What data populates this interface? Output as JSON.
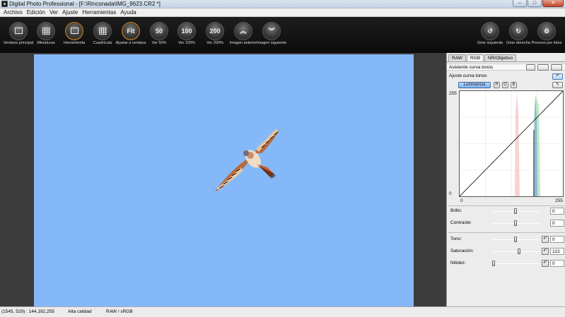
{
  "window": {
    "title": "Digital Photo Professional - [F:\\Rinconada\\IMG_9623.CR2 *]",
    "buttons": {
      "minimize": "–",
      "maximize": "□",
      "close": "✕"
    }
  },
  "menu": [
    "Archivo",
    "Edición",
    "Ver",
    "Ajuste",
    "Herramientas",
    "Ayuda"
  ],
  "toolbar": {
    "tools": [
      {
        "id": "ventana-principal",
        "label": "Ventana principal",
        "icon": "folder-icon",
        "glyph": ""
      },
      {
        "id": "miniaturas",
        "label": "Miniaturas",
        "icon": "thumbnails-icon",
        "glyph": ""
      },
      {
        "id": "herramienta",
        "label": "Herramienta",
        "icon": "tool-palette-icon",
        "glyph": ""
      },
      {
        "id": "cuadricula",
        "label": "Cuadrícula",
        "icon": "grid-icon",
        "glyph": ""
      },
      {
        "id": "ajustar-a-ventana",
        "label": "Ajustar a ventana",
        "icon": "fit-window-icon",
        "glyph": "Fit"
      },
      {
        "id": "ver-50",
        "label": "Ver 50%",
        "icon": "zoom-50-icon",
        "glyph": "50"
      },
      {
        "id": "ver-100",
        "label": "Ver 100%",
        "icon": "zoom-100-icon",
        "glyph": "100"
      },
      {
        "id": "ver-200",
        "label": "Ver 200%",
        "icon": "zoom-200-icon",
        "glyph": "200"
      },
      {
        "id": "imagen-anterior",
        "label": "Imagen anterior",
        "icon": "previous-image-icon",
        "glyph": "︽"
      },
      {
        "id": "imagen-siguiente",
        "label": "Imagen siguiente",
        "icon": "next-image-icon",
        "glyph": "︾"
      }
    ],
    "right_tools": [
      {
        "id": "girar-izquierda",
        "label": "Girar izquierda",
        "icon": "rotate-left-icon",
        "glyph": "↺"
      },
      {
        "id": "girar-derecha",
        "label": "Girar derecha",
        "icon": "rotate-right-icon",
        "glyph": "↻"
      },
      {
        "id": "proceso-por-lotes",
        "label": "Proceso por lotes",
        "icon": "batch-process-icon",
        "glyph": "⚙"
      }
    ]
  },
  "viewer": {
    "background_color": "#85b8f8"
  },
  "panel": {
    "tabs": [
      "RAW",
      "RGB",
      "NR/Objetivo"
    ],
    "active_tab": "RGB",
    "assist_label": "Asistente curva tonos",
    "adjust_label": "Ajuste curva tonos",
    "channels": [
      "Luminancia",
      "R",
      "G",
      "B"
    ],
    "active_channel": "Luminancia",
    "curve": {
      "input_min": "0",
      "input_max": "255",
      "output_min": "0",
      "output_max": "255",
      "input_low_value": "0",
      "input_high_value": "255"
    },
    "sliders_group1": [
      {
        "id": "brillo",
        "label": "Brillo:",
        "value": "0",
        "level": 0.5
      },
      {
        "id": "contraste",
        "label": "Contraste:",
        "value": "0",
        "level": 0.5
      }
    ],
    "sliders_group2": [
      {
        "id": "tono",
        "label": "Tono:",
        "value": "0",
        "level": 0.5
      },
      {
        "id": "saturacion",
        "label": "Saturación:",
        "value": "122",
        "level": 0.58
      },
      {
        "id": "nitidez",
        "label": "Nitidez:",
        "value": "0",
        "level": 0.0
      }
    ]
  },
  "status": {
    "pixel": "(1545, 529) : 144,192,255",
    "quality": "Alta calidad",
    "color": "RAW / sRGB"
  }
}
